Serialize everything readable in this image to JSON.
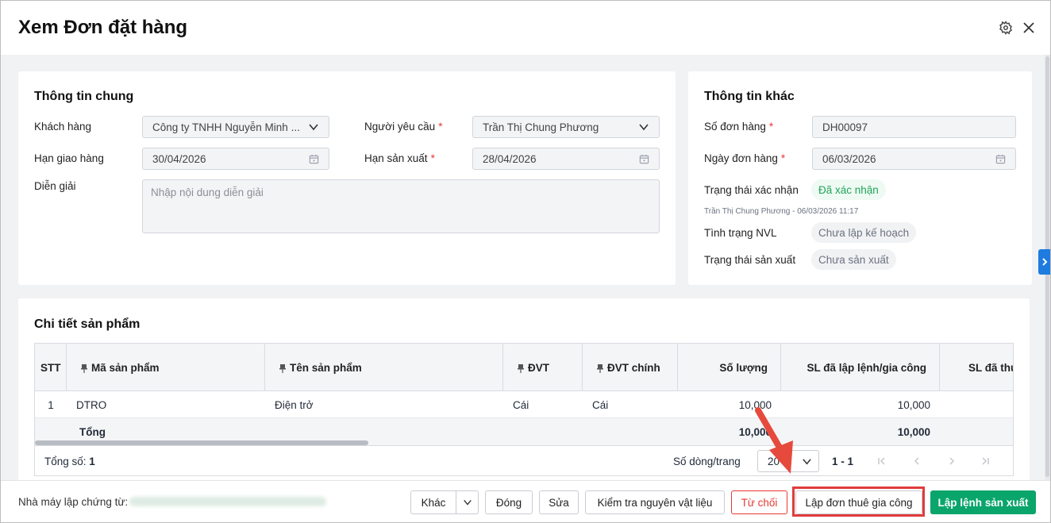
{
  "window": {
    "title": "Xem Đơn đặt hàng"
  },
  "icons": {
    "settings": "gear-icon",
    "close": "close-icon"
  },
  "general": {
    "title": "Thông tin chung",
    "customer_label": "Khách hàng",
    "customer_value": "Công ty TNHH Nguyễn Minh ...",
    "requester_label": "Người yêu cầu",
    "requester_value": "Trần Thị Chung Phương",
    "delivery_label": "Hạn giao hàng",
    "delivery_value": "30/04/2026",
    "production_label": "Hạn sản xuất",
    "production_value": "28/04/2026",
    "note_label": "Diễn giải",
    "note_placeholder": "Nhập nội dung diễn giải",
    "required_mark": "*"
  },
  "other": {
    "title": "Thông tin khác",
    "order_no_label": "Số đơn hàng",
    "order_no_value": "DH00097",
    "order_date_label": "Ngày đơn hàng",
    "order_date_value": "06/03/2026",
    "confirm_label": "Trạng thái xác nhận",
    "confirm_value": "Đã xác nhận",
    "confirm_note": "Trần Thị Chung Phương - 06/03/2026 11:17",
    "material_label": "Tình trạng NVL",
    "material_value": "Chưa lập kế hoạch",
    "production_status_label": "Trạng thái sản xuất",
    "production_status_value": "Chưa sản xuất"
  },
  "products": {
    "title": "Chi tiết sản phẩm",
    "columns": [
      "STT",
      "Mã sản phẩm",
      "Tên sản phẩm",
      "ĐVT",
      "ĐVT chính",
      "Số lượng",
      "SL đã lập lệnh/gia công",
      "SL đã thự"
    ],
    "rows": [
      {
        "stt": "1",
        "code": "DTRO",
        "name": "Điện trở",
        "unit": "Cái",
        "main_unit": "Cái",
        "qty": "10,000",
        "ordered": "10,000"
      }
    ],
    "total": {
      "label": "Tổng",
      "qty": "10,000",
      "ordered": "10,000"
    },
    "footer": {
      "total_count_label": "Tổng số:",
      "total_count": "1",
      "page_size_label": "Số dòng/trang",
      "page_size": "20",
      "range": "1 - 1"
    }
  },
  "bottom": {
    "factory_label": "Nhà máy lập chứng từ:",
    "buttons": {
      "other": "Khác",
      "close": "Đóng",
      "edit": "Sửa",
      "check_material": "Kiểm tra nguyên vật liệu",
      "reject": "Từ chối",
      "outsource": "Lập đơn thuê gia công",
      "production_order": "Lập lệnh sản xuất"
    }
  },
  "colors": {
    "primary": "#0aa56b",
    "danger": "#e53935",
    "highlight": "#e03c3c",
    "arrow": "#e64a3c",
    "side_tab": "#1e7be0"
  }
}
